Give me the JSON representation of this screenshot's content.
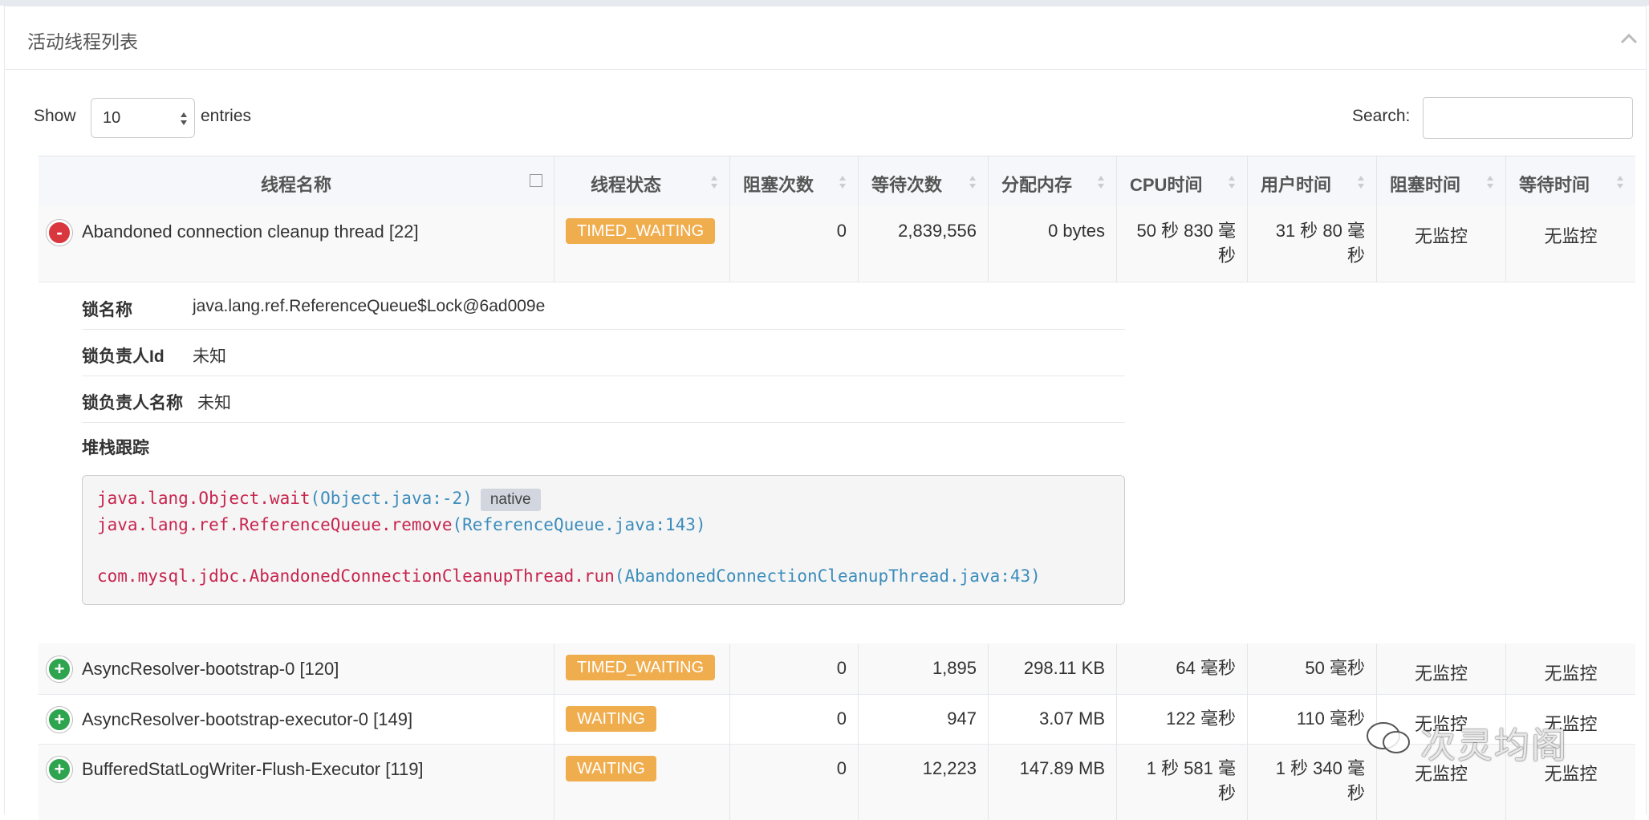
{
  "panel": {
    "title": "活动线程列表"
  },
  "controls": {
    "show_label": "Show",
    "length_value": "10",
    "entries_label": "entries",
    "search_label": "Search:",
    "search_value": ""
  },
  "columns": [
    "线程名称",
    "线程状态",
    "阻塞次数",
    "等待次数",
    "分配内存",
    "CPU时间",
    "用户时间",
    "阻塞时间",
    "等待时间"
  ],
  "rows": [
    {
      "name": "Abandoned connection cleanup thread [22]",
      "state": "TIMED_WAITING",
      "blocked": "0",
      "waited": "2,839,556",
      "memory": "0 bytes",
      "cpu_line1": "50 秒 830 毫",
      "cpu_line2": "秒",
      "user_line1": "31 秒 80 毫",
      "user_line2": "秒",
      "block_time": "无监控",
      "wait_time": "无监控",
      "expanded": true
    },
    {
      "name": "AsyncResolver-bootstrap-0 [120]",
      "state": "TIMED_WAITING",
      "blocked": "0",
      "waited": "1,895",
      "memory": "298.11 KB",
      "cpu_line1": "64 毫秒",
      "cpu_line2": "",
      "user_line1": "50 毫秒",
      "user_line2": "",
      "block_time": "无监控",
      "wait_time": "无监控",
      "expanded": false
    },
    {
      "name": "AsyncResolver-bootstrap-executor-0 [149]",
      "state": "WAITING",
      "blocked": "0",
      "waited": "947",
      "memory": "3.07 MB",
      "cpu_line1": "122 毫秒",
      "cpu_line2": "",
      "user_line1": "110 毫秒",
      "user_line2": "",
      "block_time": "无监控",
      "wait_time": "无监控",
      "expanded": false
    },
    {
      "name": "BufferedStatLogWriter-Flush-Executor [119]",
      "state": "WAITING",
      "blocked": "0",
      "waited": "12,223",
      "memory": "147.89 MB",
      "cpu_line1": "1 秒 581 毫",
      "cpu_line2": "秒",
      "user_line1": "1 秒 340 毫",
      "user_line2": "秒",
      "block_time": "无监控",
      "wait_time": "无监控",
      "expanded": false
    }
  ],
  "detail": {
    "lock_name_label": "锁名称",
    "lock_name": "java.lang.ref.ReferenceQueue$Lock@6ad009e",
    "owner_id_label": "锁负责人Id",
    "owner_id": "未知",
    "owner_name_label": "锁负责人名称",
    "owner_name": "未知",
    "stack_label": "堆栈跟踪",
    "stack": [
      {
        "method": "java.lang.Object.wait",
        "file": "(Object.java:-2)",
        "badge": "native"
      },
      {
        "method": "java.lang.ref.ReferenceQueue.remove",
        "file": "(ReferenceQueue.java:143)"
      },
      {
        "method": "com.mysql.jdbc.AbandonedConnectionCleanupThread.run",
        "file": "(AbandonedConnectionCleanupThread.java:43)"
      }
    ]
  },
  "watermark": {
    "text": "次灵均阁"
  },
  "colors": {
    "state_badge": "#f0ad4e",
    "collapse_toggle": "#d9363e",
    "expand_toggle": "#2ea44f",
    "method": "#c7254e",
    "file": "#3c8dbc"
  }
}
